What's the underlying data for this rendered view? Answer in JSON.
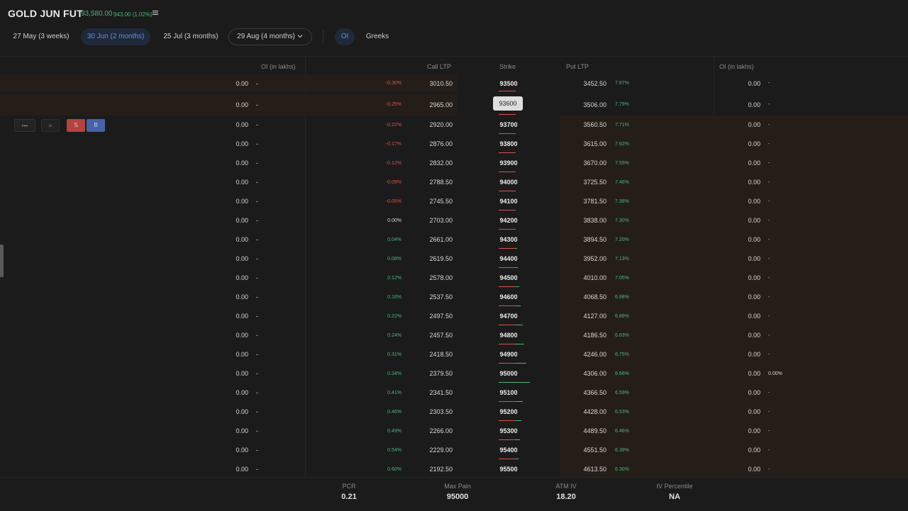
{
  "instrument": {
    "title": "GOLD JUN FUT",
    "price": "93,580.00",
    "change": "943.00 (1.02%)",
    "menu_icon": "list-icon"
  },
  "expiries": [
    {
      "label": "27 May (3 weeks)"
    },
    {
      "label": "30 Jun (2 months)",
      "selected": true
    },
    {
      "label": "25 Jul (3 months)"
    },
    {
      "label": "29 Aug (4 months)"
    }
  ],
  "view_tabs": [
    {
      "label": "OI",
      "selected": true
    },
    {
      "label": "Greeks"
    }
  ],
  "columns": {
    "call_oi": "OI (in lakhs)",
    "call_ltp": "Call LTP",
    "strike": "Strike",
    "put_ltp": "Put LTP",
    "put_oi": "OI (in lakhs)"
  },
  "row_actions": {
    "more": "•••",
    "chart": "≡",
    "sell": "S",
    "buy": "B"
  },
  "rows": [
    {
      "call_oi": "0.00",
      "call_oi_chg": "-",
      "call_chg": "-0.30%",
      "call_ltp": "3010.50",
      "strike": "93500",
      "put_ltp": "3452.50",
      "put_chg": "7.87%",
      "put_oi": "0.00",
      "put_oi_chg": "-"
    },
    {
      "call_oi": "0.00",
      "call_oi_chg": "-",
      "call_chg": "-0.25%",
      "call_ltp": "2965.00",
      "strike": "93600",
      "put_ltp": "3506.00",
      "put_chg": "7.79%",
      "put_oi": "0.00",
      "put_oi_chg": "-"
    },
    {
      "call_oi": "0.00",
      "call_oi_chg": "-",
      "call_chg": "-0.22%",
      "call_ltp": "2920.00",
      "strike": "93700",
      "put_ltp": "3560.50",
      "put_chg": "7.71%",
      "put_oi": "0.00",
      "put_oi_chg": "-"
    },
    {
      "call_oi": "0.00",
      "call_oi_chg": "-",
      "call_chg": "-0.17%",
      "call_ltp": "2876.00",
      "strike": "93800",
      "put_ltp": "3615.00",
      "put_chg": "7.62%",
      "put_oi": "0.00",
      "put_oi_chg": "-"
    },
    {
      "call_oi": "0.00",
      "call_oi_chg": "-",
      "call_chg": "-0.12%",
      "call_ltp": "2832.00",
      "strike": "93900",
      "put_ltp": "3670.00",
      "put_chg": "7.55%",
      "put_oi": "0.00",
      "put_oi_chg": "-"
    },
    {
      "call_oi": "0.00",
      "call_oi_chg": "-",
      "call_chg": "-0.09%",
      "call_ltp": "2788.50",
      "strike": "94000",
      "put_ltp": "3725.50",
      "put_chg": "7.46%",
      "put_oi": "0.00",
      "put_oi_chg": "-"
    },
    {
      "call_oi": "0.00",
      "call_oi_chg": "-",
      "call_chg": "-0.05%",
      "call_ltp": "2745.50",
      "strike": "94100",
      "put_ltp": "3781.50",
      "put_chg": "7.38%",
      "put_oi": "0.00",
      "put_oi_chg": "-"
    },
    {
      "call_oi": "0.00",
      "call_oi_chg": "-",
      "call_chg": "0.00%",
      "call_ltp": "2703.00",
      "strike": "94200",
      "put_ltp": "3838.00",
      "put_chg": "7.30%",
      "put_oi": "0.00",
      "put_oi_chg": "-"
    },
    {
      "call_oi": "0.00",
      "call_oi_chg": "-",
      "call_chg": "0.04%",
      "call_ltp": "2661.00",
      "strike": "94300",
      "put_ltp": "3894.50",
      "put_chg": "7.20%",
      "put_oi": "0.00",
      "put_oi_chg": "-"
    },
    {
      "call_oi": "0.00",
      "call_oi_chg": "-",
      "call_chg": "0.08%",
      "call_ltp": "2619.50",
      "strike": "94400",
      "put_ltp": "3952.00",
      "put_chg": "7.13%",
      "put_oi": "0.00",
      "put_oi_chg": "-"
    },
    {
      "call_oi": "0.00",
      "call_oi_chg": "-",
      "call_chg": "0.12%",
      "call_ltp": "2578.00",
      "strike": "94500",
      "put_ltp": "4010.00",
      "put_chg": "7.05%",
      "put_oi": "0.00",
      "put_oi_chg": "-"
    },
    {
      "call_oi": "0.00",
      "call_oi_chg": "-",
      "call_chg": "0.16%",
      "call_ltp": "2537.50",
      "strike": "94600",
      "put_ltp": "4068.50",
      "put_chg": "6.98%",
      "put_oi": "0.00",
      "put_oi_chg": "-"
    },
    {
      "call_oi": "0.00",
      "call_oi_chg": "-",
      "call_chg": "0.22%",
      "call_ltp": "2497.50",
      "strike": "94700",
      "put_ltp": "4127.00",
      "put_chg": "6.89%",
      "put_oi": "0.00",
      "put_oi_chg": "-"
    },
    {
      "call_oi": "0.00",
      "call_oi_chg": "-",
      "call_chg": "0.24%",
      "call_ltp": "2457.50",
      "strike": "94800",
      "put_ltp": "4186.50",
      "put_chg": "6.83%",
      "put_oi": "0.00",
      "put_oi_chg": "-"
    },
    {
      "call_oi": "0.00",
      "call_oi_chg": "-",
      "call_chg": "0.31%",
      "call_ltp": "2418.50",
      "strike": "94900",
      "put_ltp": "4246.00",
      "put_chg": "6.75%",
      "put_oi": "0.00",
      "put_oi_chg": "-"
    },
    {
      "call_oi": "0.00",
      "call_oi_chg": "-",
      "call_chg": "0.34%",
      "call_ltp": "2379.50",
      "strike": "95000",
      "put_ltp": "4306.00",
      "put_chg": "6.66%",
      "put_oi": "0.00",
      "put_oi_chg": "0.00%"
    },
    {
      "call_oi": "0.00",
      "call_oi_chg": "-",
      "call_chg": "0.41%",
      "call_ltp": "2341.50",
      "strike": "95100",
      "put_ltp": "4366.50",
      "put_chg": "6.59%",
      "put_oi": "0.00",
      "put_oi_chg": "-"
    },
    {
      "call_oi": "0.00",
      "call_oi_chg": "-",
      "call_chg": "0.46%",
      "call_ltp": "2303.50",
      "strike": "95200",
      "put_ltp": "4428.00",
      "put_chg": "6.53%",
      "put_oi": "0.00",
      "put_oi_chg": "-"
    },
    {
      "call_oi": "0.00",
      "call_oi_chg": "-",
      "call_chg": "0.49%",
      "call_ltp": "2266.00",
      "strike": "95300",
      "put_ltp": "4489.50",
      "put_chg": "6.46%",
      "put_oi": "0.00",
      "put_oi_chg": "-"
    },
    {
      "call_oi": "0.00",
      "call_oi_chg": "-",
      "call_chg": "0.54%",
      "call_ltp": "2229.00",
      "strike": "95400",
      "put_ltp": "4551.50",
      "put_chg": "6.39%",
      "put_oi": "0.00",
      "put_oi_chg": "-"
    },
    {
      "call_oi": "0.00",
      "call_oi_chg": "-",
      "call_chg": "0.60%",
      "call_ltp": "2192.50",
      "strike": "95500",
      "put_ltp": "4613.50",
      "put_chg": "6.30%",
      "put_oi": "0.00",
      "put_oi_chg": "-"
    }
  ],
  "stats": [
    {
      "label": "PCR",
      "value": "0.21"
    },
    {
      "label": "Max Pain",
      "value": "95000"
    },
    {
      "label": "ATM IV",
      "value": "18.20"
    },
    {
      "label": "IV Percentile",
      "value": "NA"
    }
  ],
  "colors": {
    "positive": "#48b87a",
    "negative": "#d9534f",
    "accent": "#5d8ee8",
    "itm_bg": "#251e18"
  }
}
